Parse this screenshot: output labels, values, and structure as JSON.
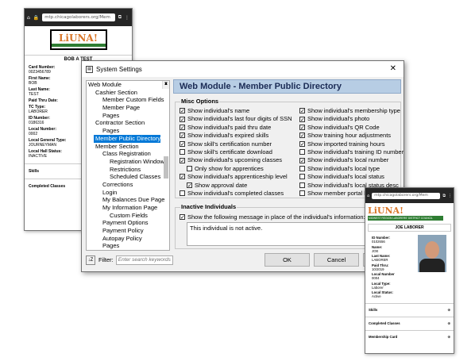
{
  "phone_left": {
    "url": "mtp.chicagolaborers.org/Mem",
    "logo": "LiUNA!",
    "member_name": "BOB A TEST",
    "fields": [
      {
        "label": "Card Number:",
        "value": "0023456789"
      },
      {
        "label": "First Name:",
        "value": "BOB"
      },
      {
        "label": "Last Name:",
        "value": "TEST"
      },
      {
        "label": "Paid Thru Date:",
        "value": ""
      },
      {
        "label": "TC Type:",
        "value": "LABORER"
      },
      {
        "label": "ID Number:",
        "value": "0186316"
      },
      {
        "label": "Local Number:",
        "value": "0002"
      },
      {
        "label": "Local General Type:",
        "value": "JOURNEYMAN"
      },
      {
        "label": "Local Hall Status:",
        "value": "INACTIVE"
      }
    ],
    "sections": [
      "Skills",
      "Completed Classes"
    ]
  },
  "dialog": {
    "title": "System Settings",
    "close": "✕",
    "tree": [
      "Web Module",
      "Cashier Section",
      "Member Custom Fields",
      "Member Page",
      "Pages",
      "Contractor Section",
      "Pages",
      "Member Public Directory",
      "Member Section",
      "Class Registration",
      "Registration Window",
      "Restrictions",
      "Scheduled Classes",
      "Corrections",
      "Login",
      "My Balances Due Page",
      "My Information Page",
      "Custom Fields",
      "Payment Options",
      "Payment Policy",
      "Autopay Policy",
      "Pages"
    ],
    "header": "Web Module - Member Public Directory",
    "misc_title": "Misc Options",
    "left_options": [
      {
        "label": "Show individual's name",
        "checked": true
      },
      {
        "label": "Show individual's last four digits of SSN",
        "checked": true
      },
      {
        "label": "Show individual's paid thru date",
        "checked": true
      },
      {
        "label": "Show individual's expired skills",
        "checked": true
      },
      {
        "label": "Show skill's certification number",
        "checked": true
      },
      {
        "label": "Show skill's certificate download",
        "checked": false
      },
      {
        "label": "Show individual's upcoming classes",
        "checked": true
      },
      {
        "label": "Only show for apprentices",
        "checked": false
      },
      {
        "label": "Show individual's apprenticeship level",
        "checked": true
      },
      {
        "label": "Show approval date",
        "checked": true
      },
      {
        "label": "Show individual's completed classes",
        "checked": false
      }
    ],
    "right_options": [
      {
        "label": "Show individual's membership type",
        "checked": true
      },
      {
        "label": "Show individual's photo",
        "checked": true
      },
      {
        "label": "Show individual's QR Code",
        "checked": true
      },
      {
        "label": "Show training hour adjustments",
        "checked": true
      },
      {
        "label": "Show imported training hours",
        "checked": true
      },
      {
        "label": "Show individual's training ID number",
        "checked": false
      },
      {
        "label": "Show individual's local number",
        "checked": true
      },
      {
        "label": "Show individual's local type",
        "checked": false
      },
      {
        "label": "Show individual's local status",
        "checked": false
      },
      {
        "label": "Show individual's local status desc",
        "checked": false
      },
      {
        "label": "Show member portal logi",
        "checked": false
      }
    ],
    "inactive_title": "Inactive Individuals",
    "inactive_option": "Show the following message in place of the individual's information:",
    "inactive_message": "This individual is not active.",
    "filter_label": "Filter:",
    "filter_placeholder": "Enter search keywords",
    "ok": "OK",
    "cancel": "Cancel"
  },
  "phone_right": {
    "url": "mtp.chicagolaborers.org/Mem",
    "logo": "LiUNA!",
    "logo_tag": "MIDWEST REGION LABORERS' DISTRICT COUNCIL",
    "member_name": "JOE LABORER",
    "fields": [
      {
        "label": "ID Number:",
        "value": "0102656"
      },
      {
        "label": "Name:",
        "value": "JOE"
      },
      {
        "label": "Last Name:",
        "value": "LABORER"
      },
      {
        "label": "Paid Thru:",
        "value": "10/2019"
      },
      {
        "label": "Local Number",
        "value": "0004"
      },
      {
        "label": "Local Type:",
        "value": "Laborer"
      },
      {
        "label": "Local Status:",
        "value": "Active"
      }
    ],
    "sections": [
      "Skills",
      "Completed Classes",
      "Membership Card"
    ]
  }
}
